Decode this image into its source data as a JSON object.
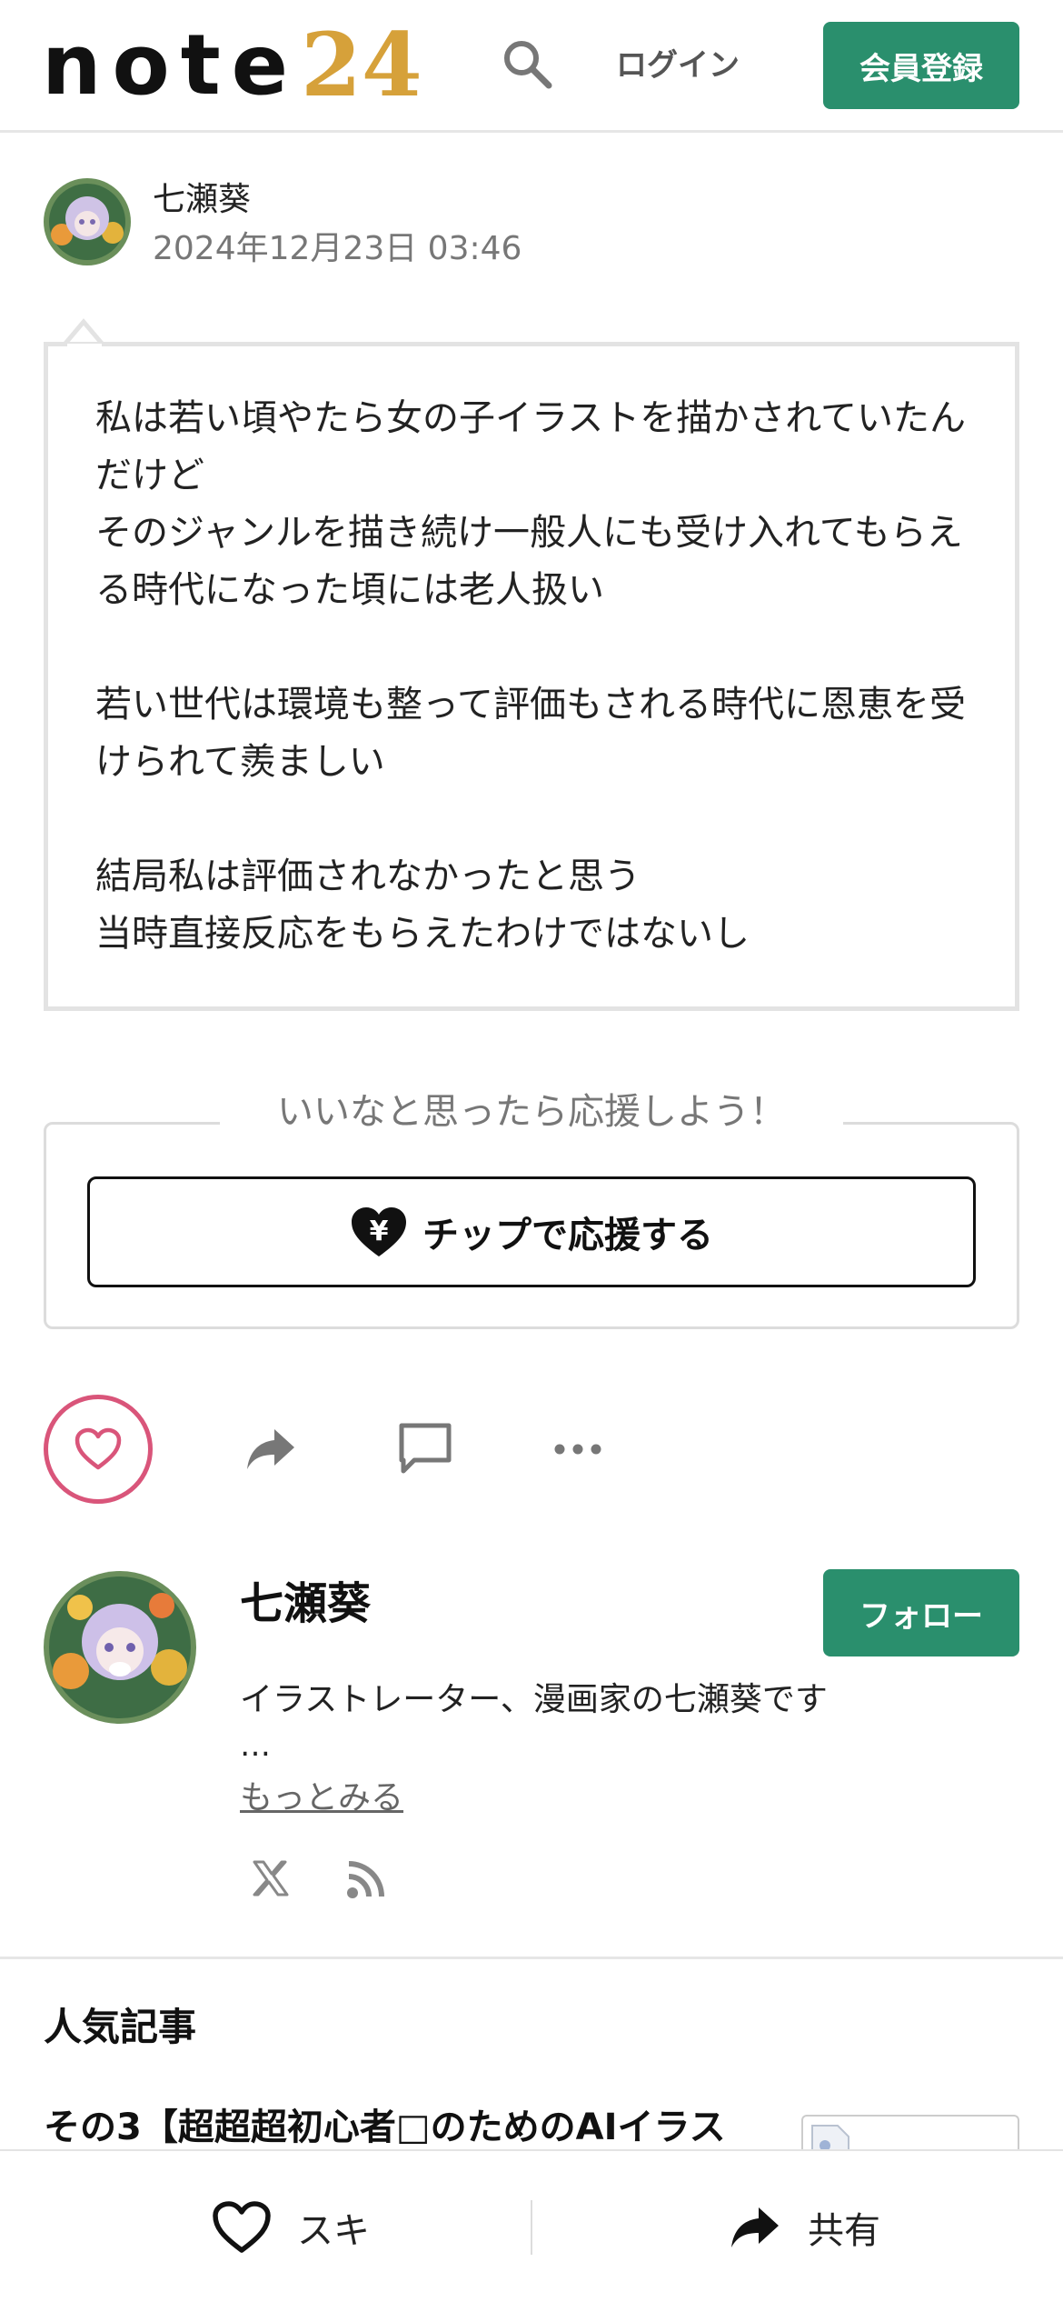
{
  "header": {
    "logo_text": "note",
    "logo_badge": "24",
    "login_label": "ログイン",
    "signup_label": "会員登録"
  },
  "post": {
    "author_name": "七瀬葵",
    "date": "2024年12月23日 03:46",
    "body": "私は若い頃やたら女の子イラストを描かされていたんだけど\nそのジャンルを描き続け一般人にも受け入れてもらえる時代になった頃には老人扱い\n\n若い世代は環境も整って評価もされる時代に恩恵を受けられて羨ましい\n\n結局私は評価されなかったと思う\n当時直接反応をもらえたわけではないし"
  },
  "tip": {
    "title": "いいなと思ったら応援しよう！",
    "button_label": "チップで応援する",
    "icon_glyph": "¥"
  },
  "creator": {
    "name": "七瀬葵",
    "follow_label": "フォロー",
    "bio": "イラストレーター、漫画家の七瀬葵です",
    "ellipsis": "…",
    "see_more": "もっとみる"
  },
  "popular": {
    "heading": "人気記事",
    "items": [
      {
        "title": "その3【超超超初心者□のためのAIイラス"
      }
    ]
  },
  "bottom_bar": {
    "like_label": "スキ",
    "share_label": "共有"
  },
  "colors": {
    "brand_green": "#2a8f6d",
    "like_pink": "#d9557a",
    "text": "#222222",
    "muted": "#777777"
  }
}
